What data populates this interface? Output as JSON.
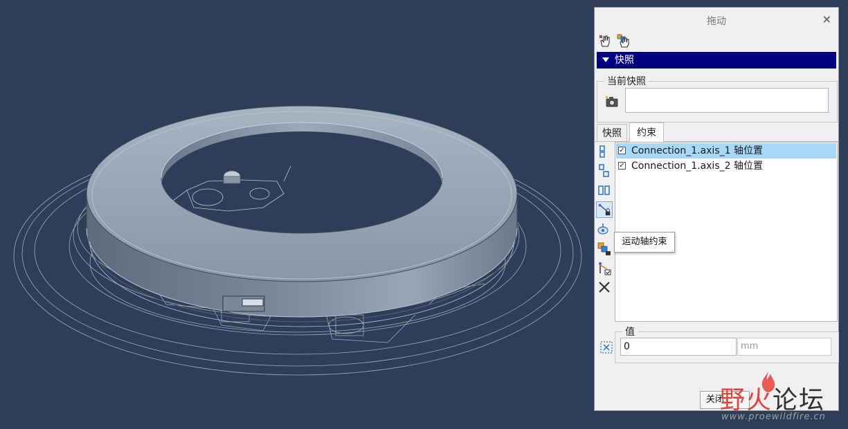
{
  "dialog": {
    "title": "拖动",
    "close_symbol": "×",
    "snapshot_section_label": "快照",
    "current_snapshot_label": "当前快照",
    "tabs": [
      {
        "label": "快照",
        "active": false
      },
      {
        "label": "约束",
        "active": true
      }
    ],
    "constraints": [
      {
        "label": "Connection_1.axis_1 轴位置",
        "checked": true,
        "selected": true
      },
      {
        "label": "Connection_1.axis_2 轴位置",
        "checked": true,
        "selected": false
      }
    ],
    "tooltip": "运动轴约束",
    "value_group_label": "值",
    "value": "0",
    "unit_placeholder": "mm",
    "close_button_label": "关闭"
  },
  "watermark": {
    "text_part1": "野火",
    "text_part2": "论坛",
    "url": "www.proewildfire.cn"
  },
  "colors": {
    "background": "#2c3e58",
    "section_header": "#000080",
    "selection": "#a8d8f8",
    "model": "#8d9bab",
    "annotation_arrow": "#e53030"
  },
  "icons": [
    "point-drag-icon",
    "body-drag-icon",
    "snapshot-camera-icon",
    "align-edges-icon",
    "align-points-icon",
    "parallel-icon",
    "motion-axis-constraint-icon",
    "body-constraint-icon",
    "lock-body-icon",
    "enable-constraint-icon",
    "delete-icon",
    "value-icon"
  ]
}
